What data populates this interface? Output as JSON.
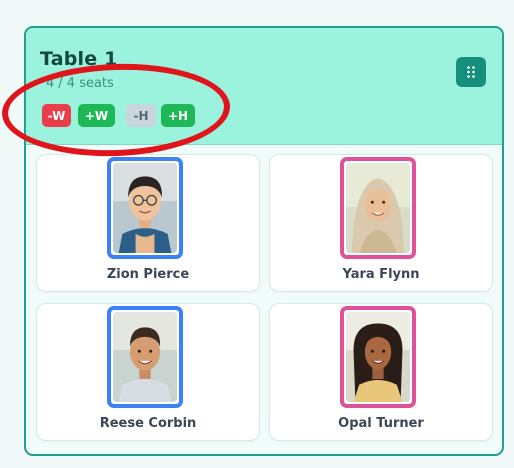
{
  "table": {
    "title": "Table 1",
    "seat_count": "4",
    "seat_text": "/ 4 seats",
    "menu_icon": "drag-grip-icon"
  },
  "controls": [
    {
      "label": "-W",
      "color": "#ea3e4c"
    },
    {
      "label": "+W",
      "color": "#1eb956"
    },
    {
      "label": "-H",
      "color": "#c9d6de"
    },
    {
      "label": "+H",
      "color": "#1eb956"
    }
  ],
  "students": [
    {
      "name": "Zion Pierce",
      "frame_color": "#3b82f6"
    },
    {
      "name": "Yara Flynn",
      "frame_color": "#e0519a"
    },
    {
      "name": "Reese Corbin",
      "frame_color": "#3b82f6"
    },
    {
      "name": "Opal Turner",
      "frame_color": "#e0519a"
    }
  ],
  "colors": {
    "header": "#9cf3dd",
    "border": "#1fa08c",
    "accent": "#17907b"
  }
}
